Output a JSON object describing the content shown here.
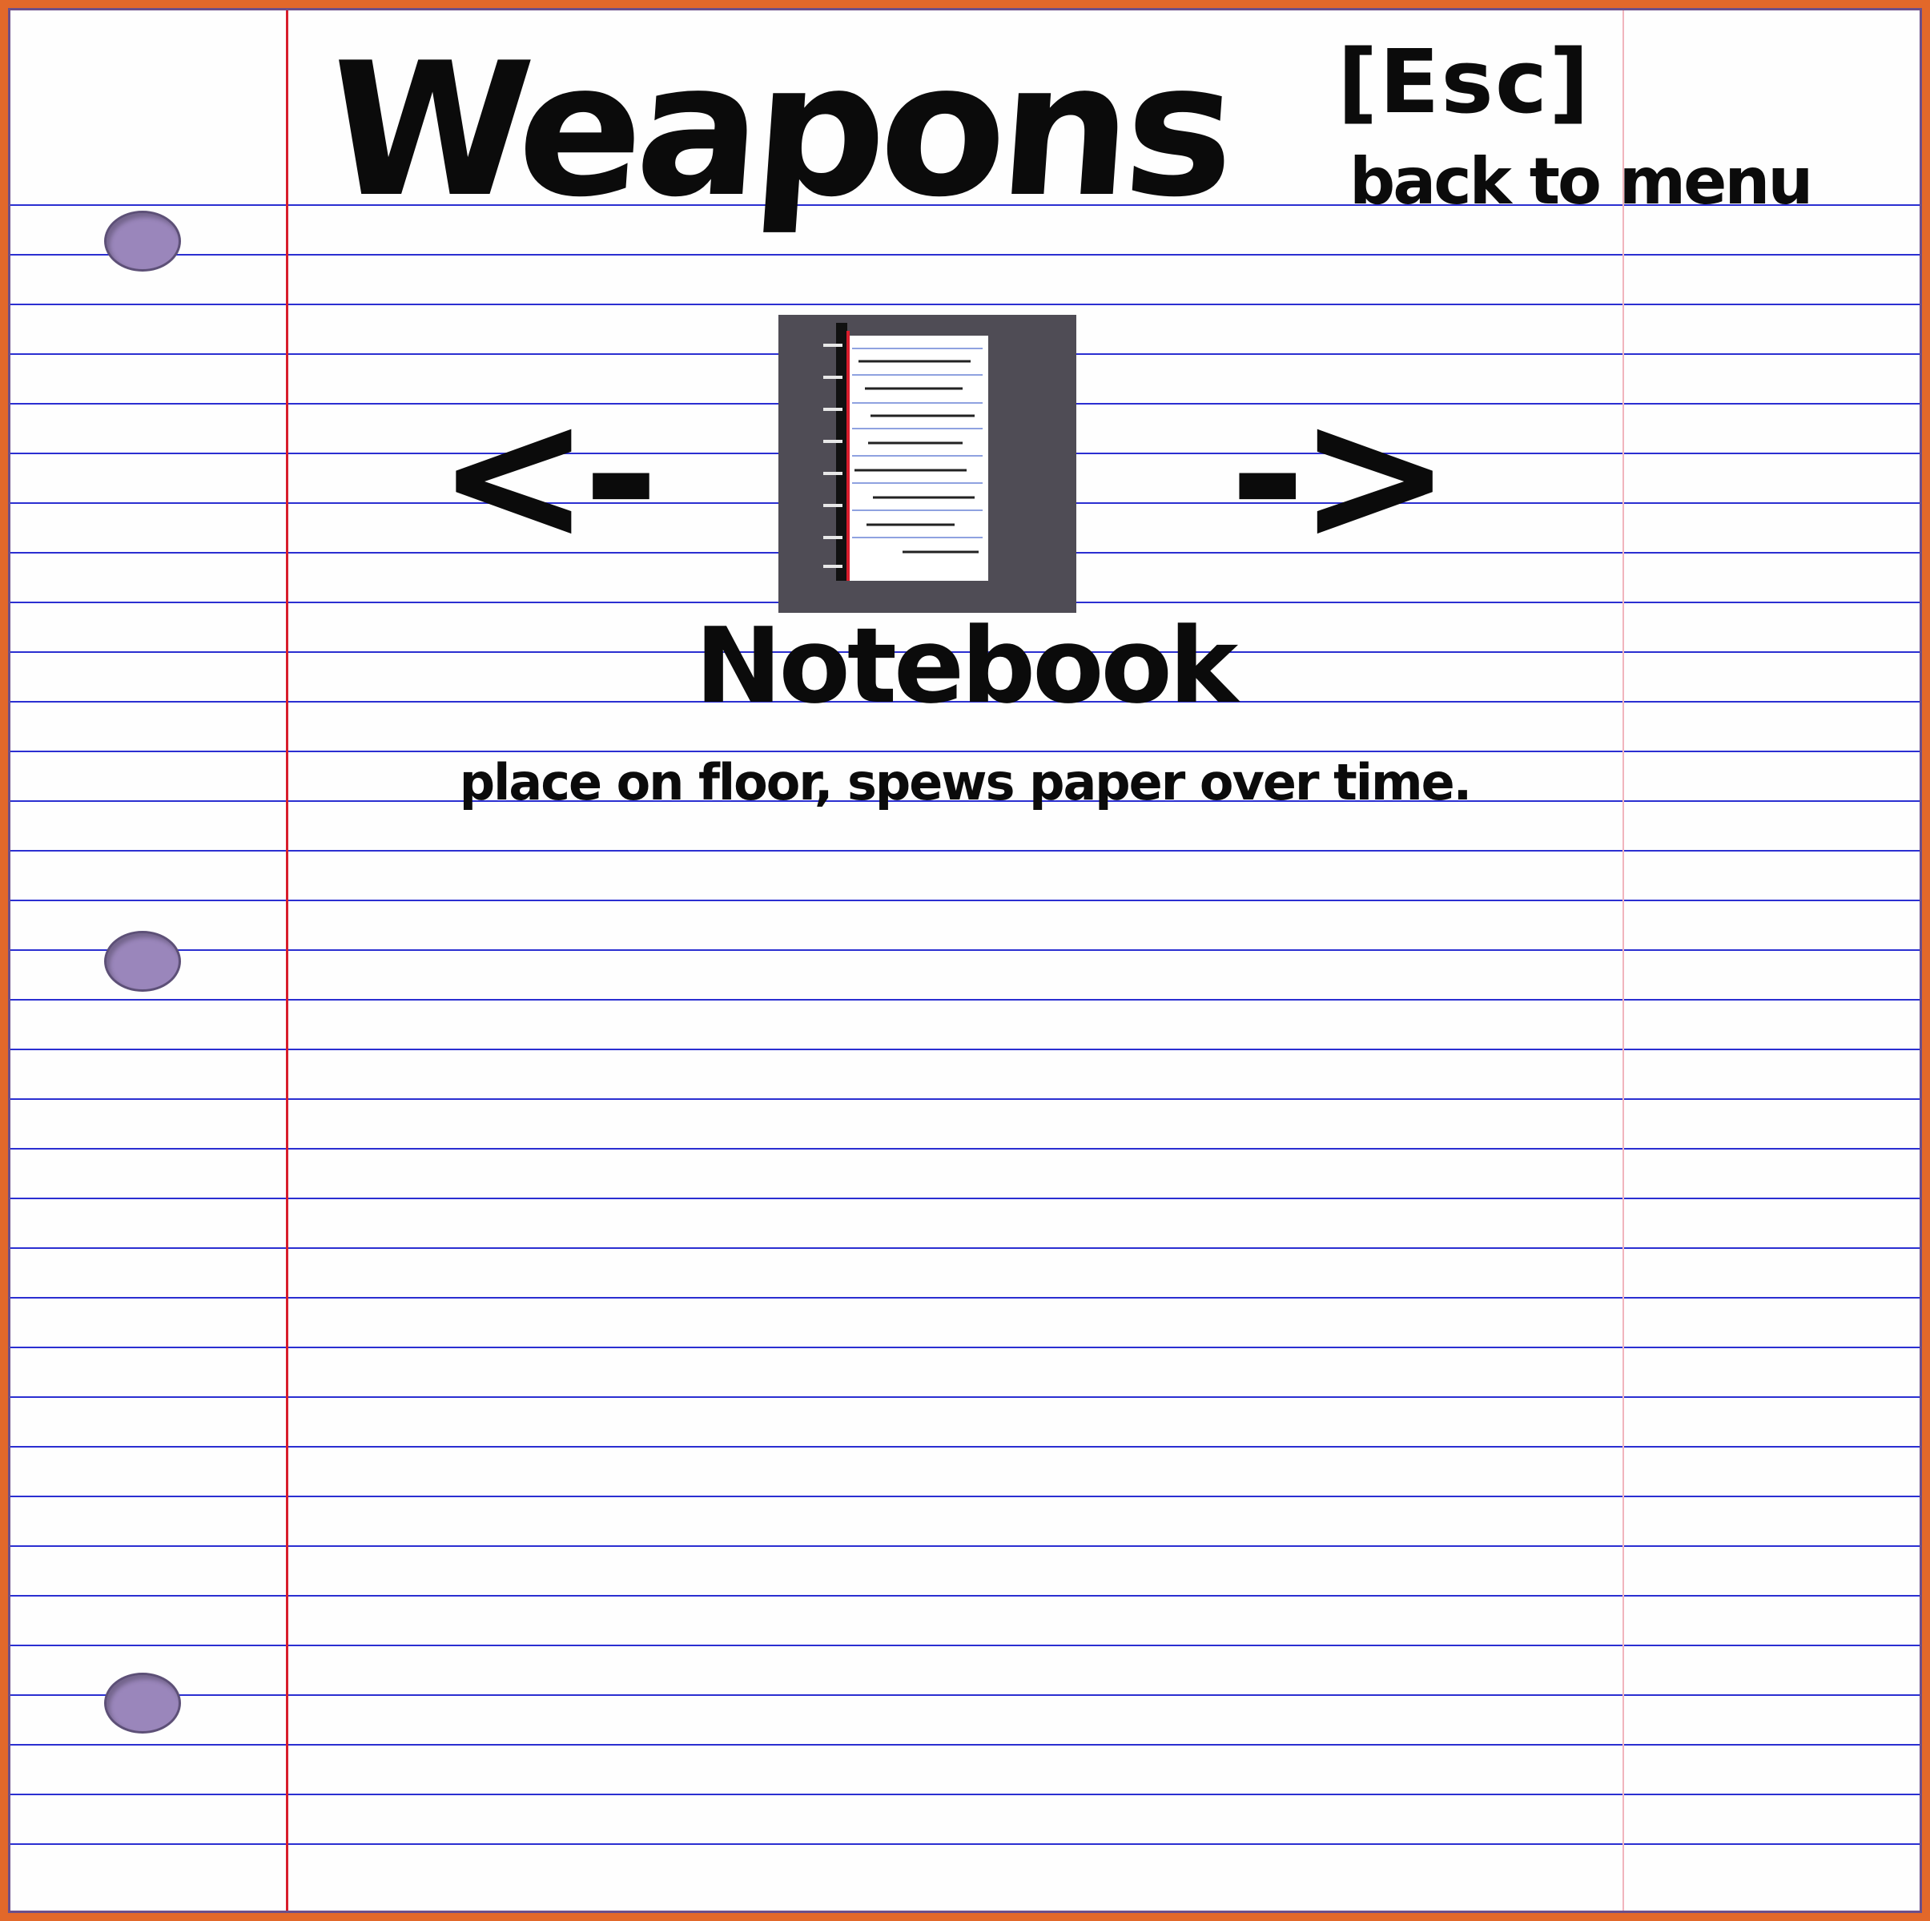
{
  "screen": {
    "title": "Weapons",
    "back": {
      "key": "[Esc]",
      "label": "back to menu"
    }
  },
  "navigation": {
    "prev_label": "<-",
    "next_label": "->"
  },
  "selected_item": {
    "name": "Notebook",
    "description": "place on floor, spews paper over time.",
    "icon": "notebook-icon"
  },
  "colors": {
    "frame": "#e2682a",
    "paper": "#fefefe",
    "ruled_line": "#2b2fd1",
    "margin_line": "#d81d2c",
    "hole": "#9a86bb",
    "icon_bg": "#4f4c55"
  }
}
